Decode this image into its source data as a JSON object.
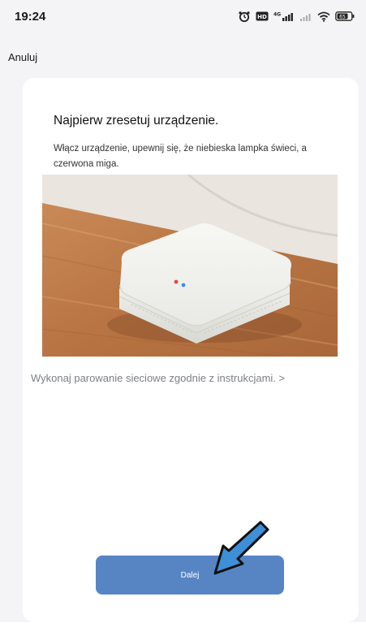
{
  "status_bar": {
    "time": "19:24",
    "battery": "65",
    "network": "4G"
  },
  "nav": {
    "cancel_label": "Anuluj"
  },
  "card": {
    "title": "Najpierw zresetuj urządzenie.",
    "description": "Włącz urządzenie, upewnij się, że niebieska lampka świeci, a czerwona miga.",
    "pairing_link": "Wykonaj parowanie sieciowe zgodnie z instrukcjami. >"
  },
  "actions": {
    "next_label": "Dalej"
  },
  "colors": {
    "accent": "#5785c4",
    "page_bg": "#f4f4f6",
    "annotation_arrow": "#3d8fd6"
  },
  "icons": {
    "alarm": "alarm-icon",
    "hd": "hd-icon",
    "signal": "signal-icon",
    "wifi": "wifi-icon",
    "battery": "battery-icon",
    "arrow": "pointer-arrow-icon"
  }
}
